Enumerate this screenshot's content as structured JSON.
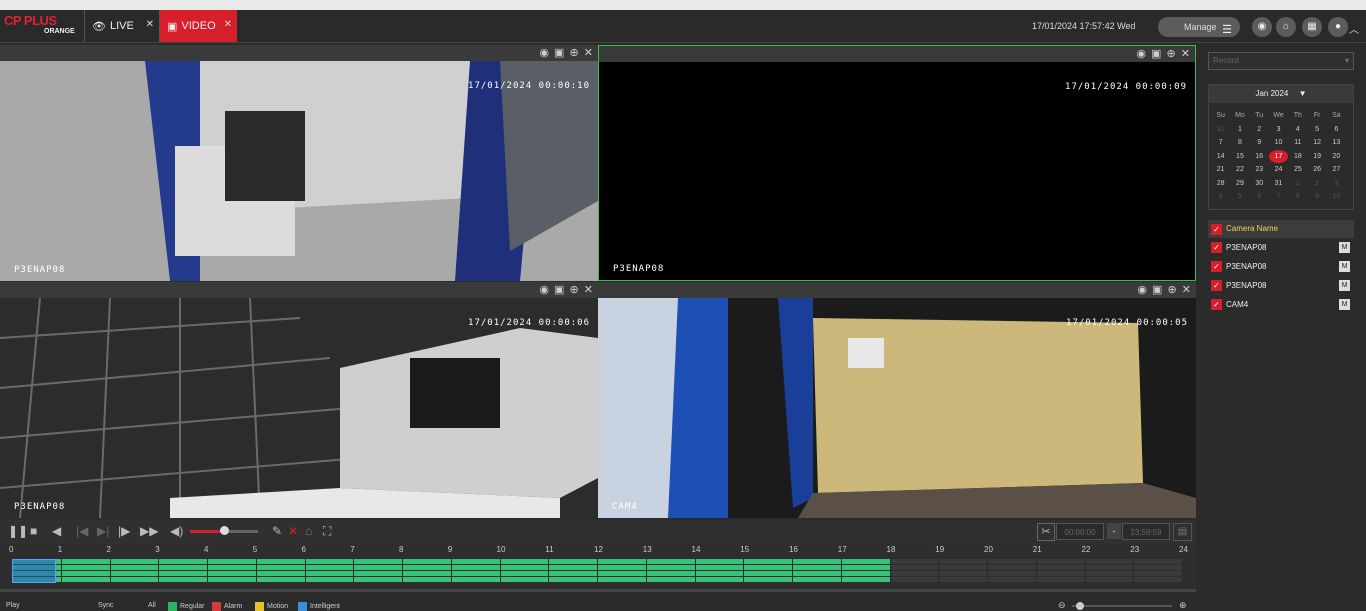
{
  "header": {
    "logo_text": "CP PLUS",
    "logo_sub": "ORANGE",
    "tabs": [
      {
        "label": "LIVE",
        "icon": "eye-icon"
      },
      {
        "label": "VIDEO",
        "icon": "video-icon"
      }
    ],
    "datetime": "17/01/2024 17:57:42 Wed",
    "manage_label": "Manage",
    "accent": "#d71f2b"
  },
  "panes": [
    {
      "time": "17/01/2024 00:00:10",
      "name": "P3ENAP08"
    },
    {
      "time": "17/01/2024 00:00:09",
      "name": "P3ENAP08"
    },
    {
      "time": "17/01/2024 00:00:06",
      "name": "P3ENAP08"
    },
    {
      "time": "17/01/2024 00:00:05",
      "name": "CAM4"
    }
  ],
  "controls": {
    "clip_start": "00:00:00",
    "clip_end": "23:59:59"
  },
  "timeline": {
    "hours": [
      "0",
      "1",
      "2",
      "3",
      "4",
      "5",
      "6",
      "7",
      "8",
      "9",
      "10",
      "11",
      "12",
      "13",
      "14",
      "15",
      "16",
      "17",
      "18",
      "19",
      "20",
      "21",
      "22",
      "23",
      "24"
    ],
    "recorded_until_hour": 18,
    "track_count": 4,
    "record_color": "#37c47a"
  },
  "bottom": {
    "play_label": "Play",
    "sync_label": "Sync",
    "all_label": "All",
    "legend": [
      {
        "label": "Regular",
        "color": "#2fb35e"
      },
      {
        "label": "Alarm",
        "color": "#d83a3a"
      },
      {
        "label": "Motion",
        "color": "#e3c12c"
      },
      {
        "label": "Intelligent",
        "color": "#3a8fd6"
      }
    ]
  },
  "sidebar": {
    "record_placeholder": "Record",
    "month_label": "Jan 2024",
    "weekdays": [
      "Su",
      "Mo",
      "Tu",
      "We",
      "Th",
      "Fr",
      "Sa"
    ],
    "days": [
      "31",
      "1",
      "2",
      "3",
      "4",
      "5",
      "6",
      "7",
      "8",
      "9",
      "10",
      "11",
      "12",
      "13",
      "14",
      "15",
      "16",
      "17",
      "18",
      "19",
      "20",
      "21",
      "22",
      "23",
      "24",
      "25",
      "26",
      "27",
      "28",
      "29",
      "30",
      "31",
      "1",
      "2",
      "3",
      "4",
      "5",
      "6",
      "7",
      "8",
      "9",
      "10"
    ],
    "selected_day": "17",
    "camera_header": "Camera Name",
    "cameras": [
      {
        "name": "P3ENAP08",
        "m": "M"
      },
      {
        "name": "P3ENAP08",
        "m": "M"
      },
      {
        "name": "P3ENAP08",
        "m": "M"
      },
      {
        "name": "CAM4",
        "m": "M"
      }
    ]
  }
}
